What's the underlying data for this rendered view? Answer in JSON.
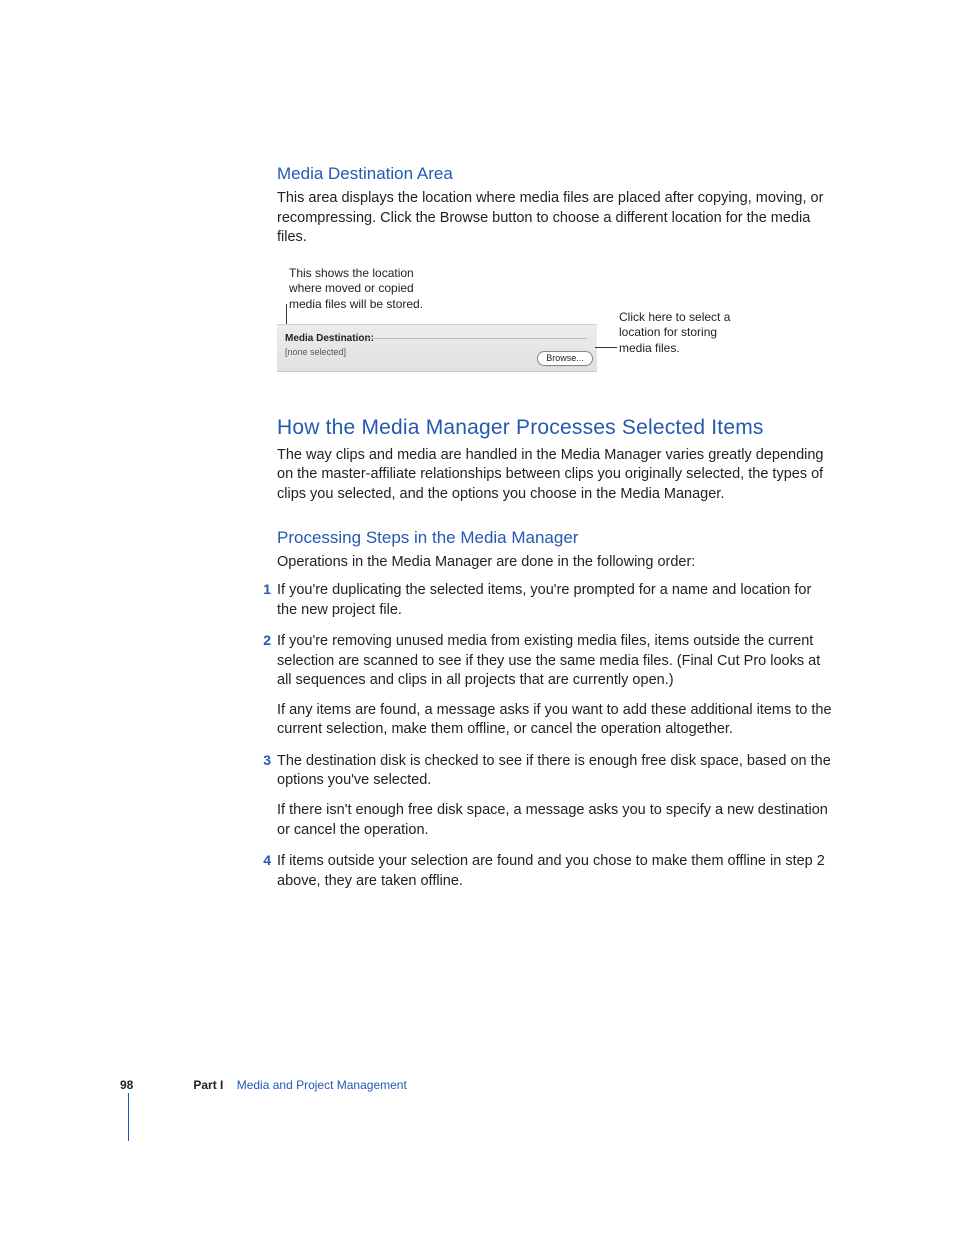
{
  "section1": {
    "heading": "Media Destination Area",
    "body": "This area displays the location where media files are placed after copying, moving, or recompressing. Click the Browse button to choose a different location for the media files."
  },
  "figure": {
    "caption_left": "This shows the location where moved or copied media files will be stored.",
    "caption_right": "Click here to select a location for storing media files.",
    "panel_label": "Media Destination:",
    "panel_value": "[none selected]",
    "browse_label": "Browse..."
  },
  "section2": {
    "heading": "How the Media Manager Processes Selected Items",
    "body": "The way clips and media are handled in the Media Manager varies greatly depending on the master-affiliate relationships between clips you originally selected, the types of clips you selected, and the options you choose in the Media Manager."
  },
  "section3": {
    "heading": "Processing Steps in the Media Manager",
    "intro": "Operations in the Media Manager are done in the following order:",
    "steps": [
      {
        "num": "1",
        "text": "If you're duplicating the selected items, you're prompted for a name and location for the new project file."
      },
      {
        "num": "2",
        "text": "If you're removing unused media from existing media files, items outside the current selection are scanned to see if they use the same media files. (Final Cut Pro looks at all sequences and clips in all projects that are currently open.)",
        "sub": "If any items are found, a message asks if you want to add these additional items to the current selection, make them offline, or cancel the operation altogether."
      },
      {
        "num": "3",
        "text": "The destination disk is checked to see if there is enough free disk space, based on the options you've selected.",
        "sub": "If there isn't enough free disk space, a message asks you to specify a new destination or cancel the operation."
      },
      {
        "num": "4",
        "text": "If items outside your selection are found and you chose to make them offline in step 2 above, they are taken offline."
      }
    ]
  },
  "footer": {
    "page_number": "98",
    "part_label": "Part I",
    "part_title": "Media and Project Management"
  }
}
